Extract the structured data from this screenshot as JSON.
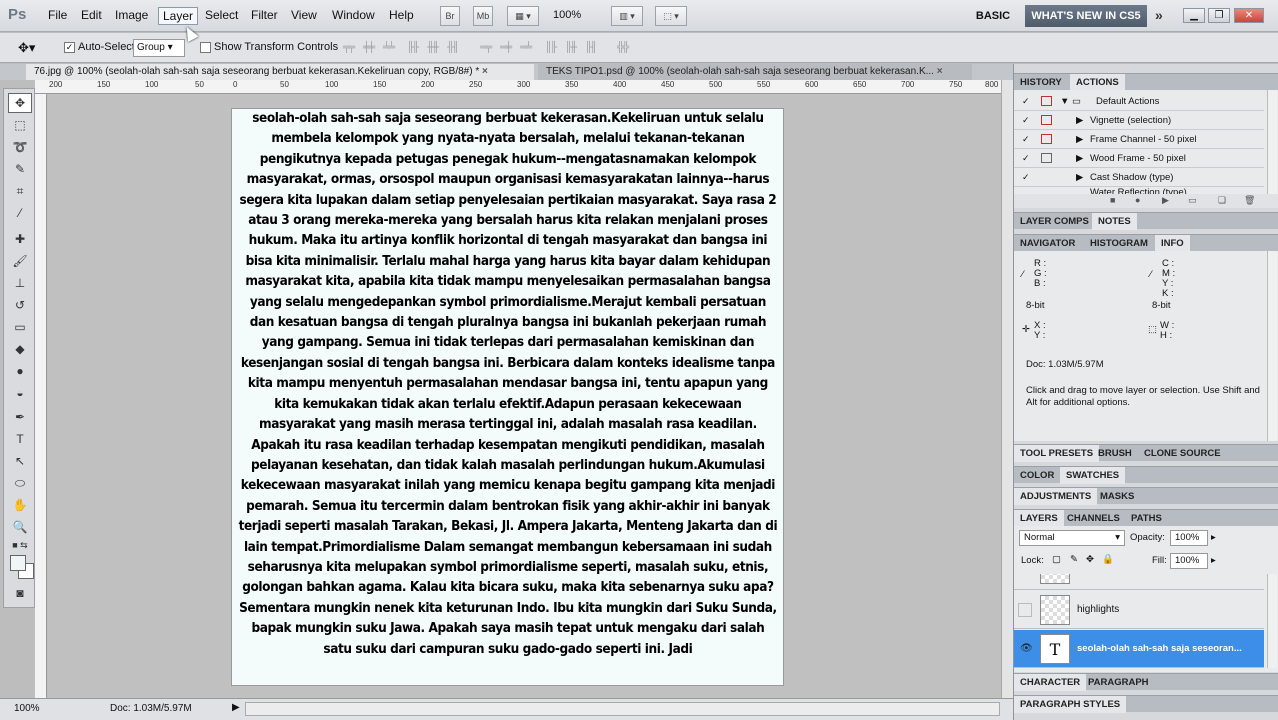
{
  "app": {
    "logo": "Ps"
  },
  "menu": [
    "File",
    "Edit",
    "Image",
    "Layer",
    "Select",
    "Filter",
    "View",
    "Window",
    "Help"
  ],
  "menubar": {
    "zoom": "100%",
    "br": "Br",
    "mb": "Mb",
    "workspace_basic": "BASIC",
    "workspace_new": "WHAT'S NEW IN CS5",
    "more": "»"
  },
  "options": {
    "auto_select_label": "Auto-Select:",
    "auto_select_checked": "✓",
    "auto_select_value": "Group",
    "show_transform_label": "Show Transform Controls"
  },
  "doc_tabs": [
    {
      "label": "76.jpg @ 100% (seolah-olah sah-sah saja seseorang berbuat kekerasan.Kekeliruan copy, RGB/8#) *",
      "close": "×"
    },
    {
      "label": "TEKS TIPO1.psd @ 100% (seolah-olah sah-sah saja seseorang berbuat kekerasan.K...",
      "close": "×"
    }
  ],
  "ruler": [
    "200",
    "150",
    "100",
    "50",
    "0",
    "50",
    "100",
    "150",
    "200",
    "250",
    "300",
    "350",
    "400",
    "450",
    "500",
    "550",
    "600",
    "650",
    "700",
    "750",
    "800"
  ],
  "document_text": "seolah-olah sah-sah saja seseorang berbuat kekerasan.Kekeliruan untuk selalu membela kelompok yang nyata-nyata bersalah, melalui tekanan-tekanan pengikutnya kepada petugas penegak hukum--mengatasnamakan kelompok masyarakat, ormas, orsospol maupun organisasi kemasyarakatan lainnya--harus segera kita lupakan dalam setiap penyelesaian pertikaian masyarakat. Saya rasa 2 atau 3 orang mereka-mereka yang bersalah harus kita relakan menjalani proses hukum. Maka itu artinya konflik horizontal di tengah masyarakat dan bangsa ini bisa kita minimalisir. Terlalu mahal harga yang harus kita bayar dalam kehidupan masyarakat kita, apabila kita tidak mampu menyelesaikan permasalahan bangsa yang selalu mengedepankan symbol primordialisme.Merajut kembali persatuan dan kesatuan bangsa di tengah pluralnya bangsa ini bukanlah pekerjaan rumah yang gampang. Semua ini tidak terlepas dari permasalahan kemiskinan dan kesenjangan sosial di tengah bangsa ini. Berbicara dalam konteks idealisme tanpa kita mampu menyentuh permasalahan mendasar bangsa ini, tentu apapun yang kita kemukakan tidak akan terlalu efektif.Adapun perasaan kekecewaan masyarakat yang masih merasa tertinggal ini, adalah masalah rasa keadilan. Apakah itu rasa keadilan terhadap kesempatan mengikuti pendidikan, masalah pelayanan kesehatan, dan tidak kalah masalah perlindungan hukum.Akumulasi kekecewaan masyarakat inilah yang memicu kenapa begitu gampang kita menjadi pemarah. Semua itu tercermin dalam bentrokan fisik yang akhir-akhir ini banyak terjadi seperti masalah Tarakan, Bekasi, Jl. Ampera Jakarta, Menteng Jakarta dan di lain tempat.Primordialisme Dalam semangat membangun kebersamaan ini sudah seharusnya kita melupakan symbol primordialisme seperti, masalah suku, etnis, golongan bahkan agama. Kalau kita bicara suku, maka kita sebenarnya suku apa? Sementara mungkin nenek kita keturunan Indo. Ibu kita mungkin dari Suku Sunda, bapak mungkin suku Jawa. Apakah saya masih tepat untuk mengaku dari salah satu suku dari campuran suku gado-gado seperti ini. Jadi",
  "status": {
    "zoom": "100%",
    "doc": "Doc: 1.03M/5.97M",
    "arrow": "▶"
  },
  "history_panel": {
    "tabs": [
      "HISTORY",
      "ACTIONS"
    ],
    "set_name": "Default Actions",
    "actions": [
      "Vignette (selection)",
      "Frame Channel - 50 pixel",
      "Wood Frame - 50 pixel",
      "Cast Shadow (type)",
      "Water Reflection (type)"
    ],
    "check": "✓"
  },
  "layer_comps_tabs": [
    "LAYER COMPS",
    "NOTES"
  ],
  "info_panel": {
    "tabs": [
      "NAVIGATOR",
      "HISTOGRAM",
      "INFO"
    ],
    "rgb_labels": "R :\nG :\nB :",
    "cmyk_labels": "C :\nM :\nY :\nK :",
    "bit_left": "8-bit",
    "bit_right": "8-bit",
    "xy": "X :\nY :",
    "wh": "W :\nH :",
    "doc": "Doc: 1.03M/5.97M",
    "hint": "Click and drag to move layer or selection.  Use Shift and Alt for additional options."
  },
  "tool_presets_tabs": [
    "TOOL PRESETS",
    "BRUSH",
    "CLONE SOURCE"
  ],
  "color_tabs": [
    "COLOR",
    "SWATCHES"
  ],
  "adjust_tabs": [
    "ADJUSTMENTS",
    "MASKS"
  ],
  "layers_panel": {
    "tabs": [
      "LAYERS",
      "CHANNELS",
      "PATHS"
    ],
    "blend": "Normal",
    "opacity_label": "Opacity:",
    "opacity": "100%",
    "lock_label": "Lock:",
    "fill_label": "Fill:",
    "fill": "100%",
    "layers": [
      "highlights",
      "seolah-olah sah-sah saja seseoran..."
    ],
    "text_thumb": "T"
  },
  "character_tabs": [
    "CHARACTER",
    "PARAGRAPH"
  ],
  "paragraph_styles": "PARAGRAPH STYLES",
  "colors": {
    "accent": "#3d8ee6",
    "whats_new": "#56626f",
    "close": "#c8473a"
  }
}
